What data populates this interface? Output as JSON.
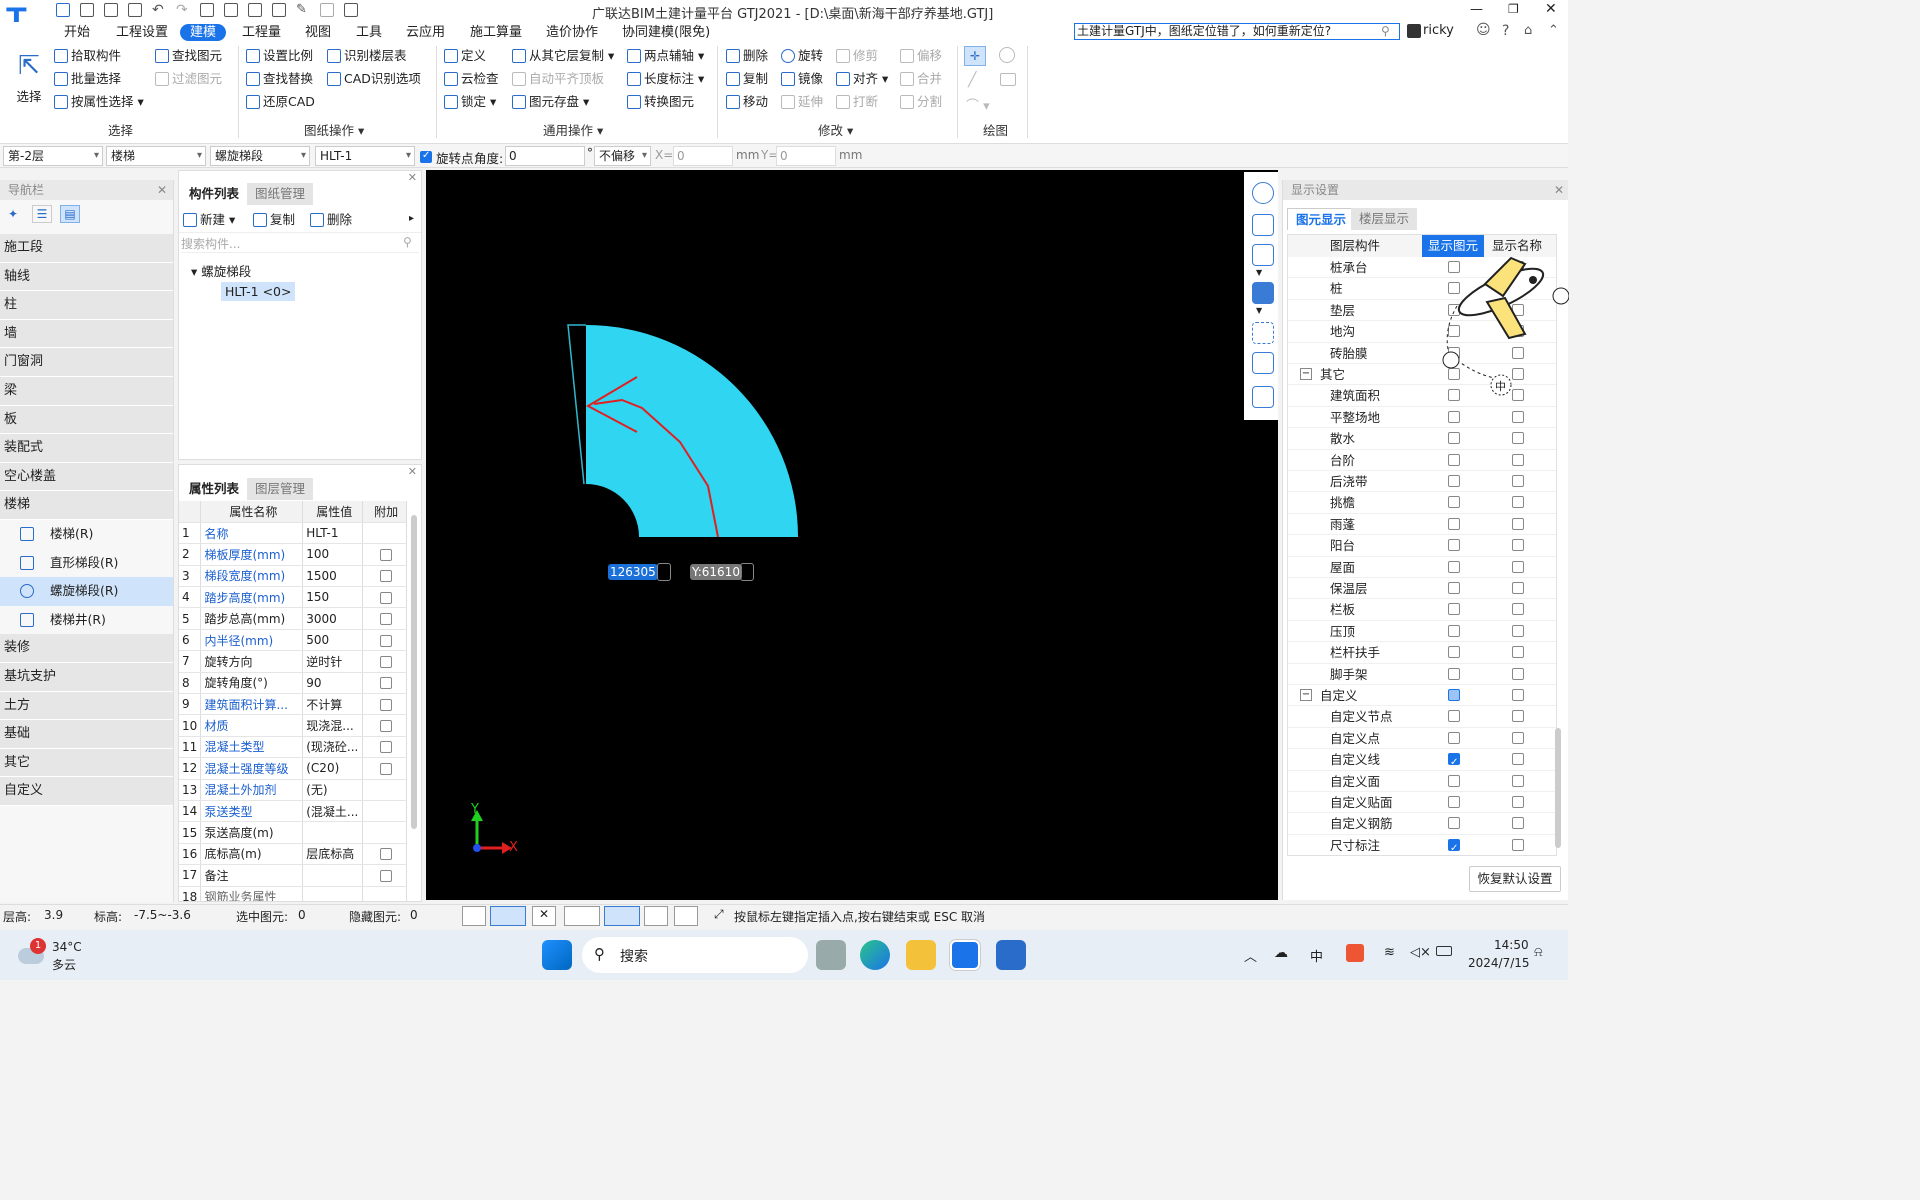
{
  "titlebar": {
    "title": "广联达BIM土建计量平台 GTJ2021 - [D:\\桌面\\新海干部疗养基地.GTJ]",
    "search": "土建计量GTJ中，图纸定位错了，如何重新定位?",
    "user": "ricky",
    "help": "?"
  },
  "menu": [
    "开始",
    "工程设置",
    "建模",
    "工程量",
    "视图",
    "工具",
    "云应用",
    "施工算量",
    "造价协作",
    "协同建模(限免)"
  ],
  "ribbon": {
    "select_label": "选择",
    "select_items": [
      "拾取构件",
      "批量选择",
      "按属性选择",
      "查找图元",
      "过滤图元"
    ],
    "select_group": "选择",
    "drawing_items": [
      "设置比例",
      "识别楼层表",
      "查找替换",
      "CAD识别选项",
      "还原CAD"
    ],
    "drawing_group": "图纸操作",
    "common_items": [
      "定义",
      "从其它层复制",
      "两点辅轴",
      "云检查",
      "自动平齐顶板",
      "长度标注",
      "锁定",
      "图元存盘",
      "转换图元"
    ],
    "common_group": "通用操作",
    "modify_items": [
      "删除",
      "旋转",
      "修剪",
      "偏移",
      "复制",
      "镜像",
      "对齐",
      "合并",
      "移动",
      "延伸",
      "打断",
      "分割"
    ],
    "modify_group": "修改",
    "draw_group": "绘图"
  },
  "options": {
    "floor": "第-2层",
    "type": "楼梯",
    "subtype": "螺旋梯段",
    "name": "HLT-1",
    "rotate_label": "旋转点",
    "angle_label": "角度:",
    "angle": "0",
    "deg": "°",
    "offset": "不偏移",
    "x_label": "X=",
    "x": "0",
    "mm1": "mm",
    "y_label": "Y=",
    "y": "0",
    "mm2": "mm"
  },
  "nav": {
    "title": "导航栏",
    "categories": [
      "施工段",
      "轴线",
      "柱",
      "墙",
      "门窗洞",
      "梁",
      "板",
      "装配式",
      "空心楼盖",
      "楼梯"
    ],
    "sub": [
      "楼梯(R)",
      "直形梯段(R)",
      "螺旋梯段(R)",
      "楼梯井(R)"
    ],
    "categories2": [
      "装修",
      "基坑支护",
      "土方",
      "基础",
      "其它",
      "自定义"
    ]
  },
  "complist": {
    "tab1": "构件列表",
    "tab2": "图纸管理",
    "new": "新建",
    "copy": "复制",
    "delete": "删除",
    "search": "搜索构件...",
    "tree_parent": "螺旋梯段",
    "tree_child": "HLT-1 <0>"
  },
  "props": {
    "tab1": "属性列表",
    "tab2": "图层管理",
    "headers": [
      "属性名称",
      "属性值",
      "附加"
    ],
    "rows": [
      {
        "n": "1",
        "name": "名称",
        "val": "HLT-1",
        "blue": true,
        "cb": false
      },
      {
        "n": "2",
        "name": "梯板厚度(mm)",
        "val": "100",
        "blue": true,
        "cb": true
      },
      {
        "n": "3",
        "name": "梯段宽度(mm)",
        "val": "1500",
        "blue": true,
        "cb": true
      },
      {
        "n": "4",
        "name": "踏步高度(mm)",
        "val": "150",
        "blue": true,
        "cb": true
      },
      {
        "n": "5",
        "name": "踏步总高(mm)",
        "val": "3000",
        "blue": false,
        "cb": true
      },
      {
        "n": "6",
        "name": "内半径(mm)",
        "val": "500",
        "blue": true,
        "cb": true
      },
      {
        "n": "7",
        "name": "旋转方向",
        "val": "逆时针",
        "blue": false,
        "cb": true
      },
      {
        "n": "8",
        "name": "旋转角度(°)",
        "val": "90",
        "blue": false,
        "cb": true
      },
      {
        "n": "9",
        "name": "建筑面积计算...",
        "val": "不计算",
        "blue": true,
        "cb": true
      },
      {
        "n": "10",
        "name": "材质",
        "val": "现浇混...",
        "blue": true,
        "cb": true
      },
      {
        "n": "11",
        "name": "混凝土类型",
        "val": "(现浇砼...",
        "blue": true,
        "cb": true
      },
      {
        "n": "12",
        "name": "混凝土强度等级",
        "val": "(C20)",
        "blue": true,
        "cb": true
      },
      {
        "n": "13",
        "name": "混凝土外加剂",
        "val": "(无)",
        "blue": true,
        "cb": false
      },
      {
        "n": "14",
        "name": "泵送类型",
        "val": "(混凝土...",
        "blue": true,
        "cb": false
      },
      {
        "n": "15",
        "name": "泵送高度(m)",
        "val": "",
        "blue": false,
        "cb": false
      },
      {
        "n": "16",
        "name": "底标高(m)",
        "val": "层底标高",
        "blue": false,
        "cb": true
      },
      {
        "n": "17",
        "name": "备注",
        "val": "",
        "blue": false,
        "cb": true
      },
      {
        "n": "18",
        "name": "钢筋业务属性",
        "val": "",
        "blue": false,
        "cb": false
      }
    ]
  },
  "canvas": {
    "coord_x": "126305",
    "coord_y": "Y:61610",
    "axis_x": "X",
    "axis_y": "Y"
  },
  "display": {
    "title": "显示设置",
    "tab1": "图元显示",
    "tab2": "楼层显示",
    "headers": [
      "图层构件",
      "显示图元",
      "显示名称"
    ],
    "rows": [
      {
        "name": "桩承台",
        "c1": "off",
        "c2": "off",
        "indent": 1
      },
      {
        "name": "桩",
        "c1": "off",
        "c2": "off",
        "indent": 1
      },
      {
        "name": "垫层",
        "c1": "off",
        "c2": "off",
        "indent": 1
      },
      {
        "name": "地沟",
        "c1": "off",
        "c2": "off",
        "indent": 1
      },
      {
        "name": "砖胎膜",
        "c1": "off",
        "c2": "off",
        "indent": 1
      },
      {
        "name": "其它",
        "c1": "off",
        "c2": "off",
        "indent": 0
      },
      {
        "name": "建筑面积",
        "c1": "off",
        "c2": "off",
        "indent": 1
      },
      {
        "name": "平整场地",
        "c1": "off",
        "c2": "off",
        "indent": 1
      },
      {
        "name": "散水",
        "c1": "off",
        "c2": "off",
        "indent": 1
      },
      {
        "name": "台阶",
        "c1": "off",
        "c2": "off",
        "indent": 1
      },
      {
        "name": "后浇带",
        "c1": "off",
        "c2": "off",
        "indent": 1
      },
      {
        "name": "挑檐",
        "c1": "off",
        "c2": "off",
        "indent": 1
      },
      {
        "name": "雨蓬",
        "c1": "off",
        "c2": "off",
        "indent": 1
      },
      {
        "name": "阳台",
        "c1": "off",
        "c2": "off",
        "indent": 1
      },
      {
        "name": "屋面",
        "c1": "off",
        "c2": "off",
        "indent": 1
      },
      {
        "name": "保温层",
        "c1": "off",
        "c2": "off",
        "indent": 1
      },
      {
        "name": "栏板",
        "c1": "off",
        "c2": "off",
        "indent": 1
      },
      {
        "name": "压顶",
        "c1": "off",
        "c2": "off",
        "indent": 1
      },
      {
        "name": "栏杆扶手",
        "c1": "off",
        "c2": "off",
        "indent": 1
      },
      {
        "name": "脚手架",
        "c1": "off",
        "c2": "off",
        "indent": 1
      },
      {
        "name": "自定义",
        "c1": "part",
        "c2": "off",
        "indent": 0
      },
      {
        "name": "自定义节点",
        "c1": "off",
        "c2": "off",
        "indent": 1
      },
      {
        "name": "自定义点",
        "c1": "off",
        "c2": "off",
        "indent": 1
      },
      {
        "name": "自定义线",
        "c1": "on",
        "c2": "off",
        "indent": 1
      },
      {
        "name": "自定义面",
        "c1": "off",
        "c2": "off",
        "indent": 1
      },
      {
        "name": "自定义贴面",
        "c1": "off",
        "c2": "off",
        "indent": 1
      },
      {
        "name": "自定义钢筋",
        "c1": "off",
        "c2": "off",
        "indent": 1
      },
      {
        "name": "尺寸标注",
        "c1": "on",
        "c2": "off",
        "indent": 1
      }
    ],
    "restore": "恢复默认设置",
    "mascot_text": "中"
  },
  "status": {
    "floor_h": "层高:",
    "floor_h_val": "3.9",
    "elev": "标高:",
    "elev_val": "-7.5~-3.6",
    "sel": "选中图元:",
    "sel_val": "0",
    "hidden": "隐藏图元:",
    "hidden_val": "0",
    "hint": "按鼠标左键指定插入点,按右键结束或 ESC 取消"
  },
  "taskbar": {
    "badge": "1",
    "temp": "34°C",
    "weather": "多云",
    "search": "搜索",
    "ime": "中",
    "time": "14:50",
    "date": "2024/7/15"
  }
}
